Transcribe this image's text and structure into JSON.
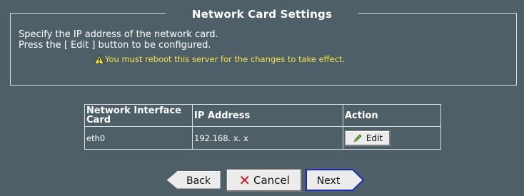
{
  "section": {
    "title": "Network Card Settings",
    "instructions": [
      "Specify the IP address of the network card.",
      "Press the [ Edit ] button to be configured."
    ],
    "warning": "You must reboot this server for the changes to take effect.",
    "warning_icon": "warning-icon"
  },
  "table": {
    "headers": [
      "Network Interface Card",
      "IP Address",
      "Action"
    ],
    "rows": [
      {
        "nic": "eth0",
        "ip": "192.168. x. x",
        "action": "Edit",
        "action_icon": "pencil-icon"
      }
    ]
  },
  "buttons": {
    "back": "Back",
    "cancel": "Cancel",
    "cancel_icon": "x-icon",
    "next": "Next"
  },
  "colors": {
    "background": "#4f5f68",
    "warning_text": "#f0e14a",
    "cancel_icon": "#d0141a",
    "next_border": "#1a2bb8"
  }
}
